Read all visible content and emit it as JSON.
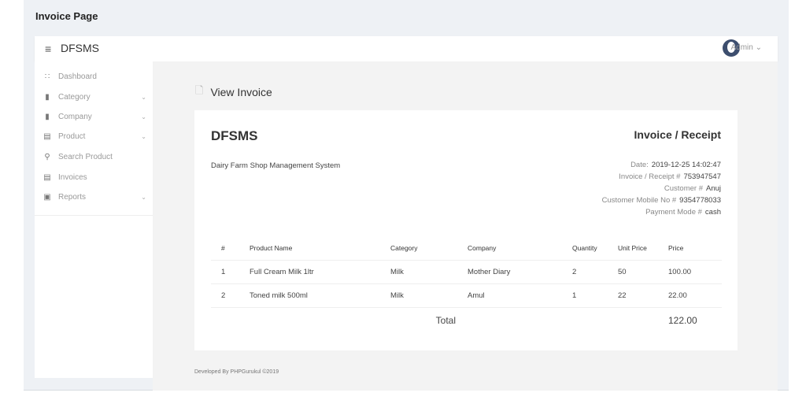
{
  "page_title": "Invoice Page",
  "header": {
    "brand": "DFSMS",
    "user": "Admin"
  },
  "sidebar": {
    "items": [
      {
        "label": "Dashboard",
        "icon": "grid-icon",
        "sub": false
      },
      {
        "label": "Category",
        "icon": "copy-icon",
        "sub": true
      },
      {
        "label": "Company",
        "icon": "copy-icon",
        "sub": true
      },
      {
        "label": "Product",
        "icon": "list-icon",
        "sub": true
      },
      {
        "label": "Search Product",
        "icon": "search-icon",
        "sub": false
      },
      {
        "label": "Invoices",
        "icon": "list-icon",
        "sub": false
      },
      {
        "label": "Reports",
        "icon": "calculator-icon",
        "sub": true
      }
    ]
  },
  "main": {
    "title": "View Invoice"
  },
  "invoice": {
    "brand": "DFSMS",
    "subtitle": "Dairy Farm Shop Management System",
    "heading": "Invoice / Receipt",
    "meta": [
      {
        "label": "Date:",
        "value": "2019-12-25 14:02:47"
      },
      {
        "label": "Invoice / Receipt #",
        "value": "753947547"
      },
      {
        "label": "Customer #",
        "value": "Anuj"
      },
      {
        "label": "Customer Mobile No #",
        "value": "9354778033"
      },
      {
        "label": "Payment Mode #",
        "value": "cash"
      }
    ],
    "columns": [
      "#",
      "Product Name",
      "Category",
      "Company",
      "Quantity",
      "Unit Price",
      "Price"
    ],
    "rows": [
      [
        "1",
        "Full Cream Milk 1ltr",
        "Milk",
        "Mother Diary",
        "2",
        "50",
        "100.00"
      ],
      [
        "2",
        "Toned milk 500ml",
        "Milk",
        "Amul",
        "1",
        "22",
        "22.00"
      ]
    ],
    "total_label": "Total",
    "total": "122.00"
  },
  "footer": "Developed By PHPGurukul ©2019"
}
